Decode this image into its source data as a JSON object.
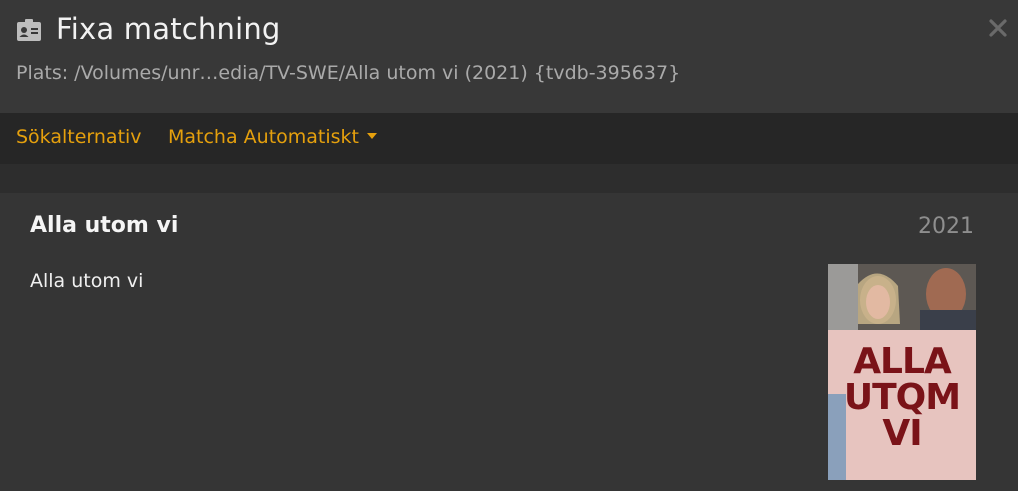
{
  "header": {
    "title": "Fixa matchning",
    "location": "Plats: /Volumes/unr…edia/TV-SWE/Alla utom vi (2021) {tvdb-395637}",
    "icon": "id-card-icon",
    "close_icon": "close-icon"
  },
  "tabs": {
    "search_options": "Sökalternativ",
    "auto_match": "Matcha Automatiskt"
  },
  "result": {
    "title": "Alla utom vi",
    "year": "2021",
    "subtitle": "Alla utom vi",
    "poster_text": "ALLA UTQM VI"
  },
  "colors": {
    "accent": "#e5a00d",
    "header_bg": "#383838",
    "tabbar_bg": "#262626",
    "result_bg": "#353535",
    "poster_title": "#7a1318"
  }
}
